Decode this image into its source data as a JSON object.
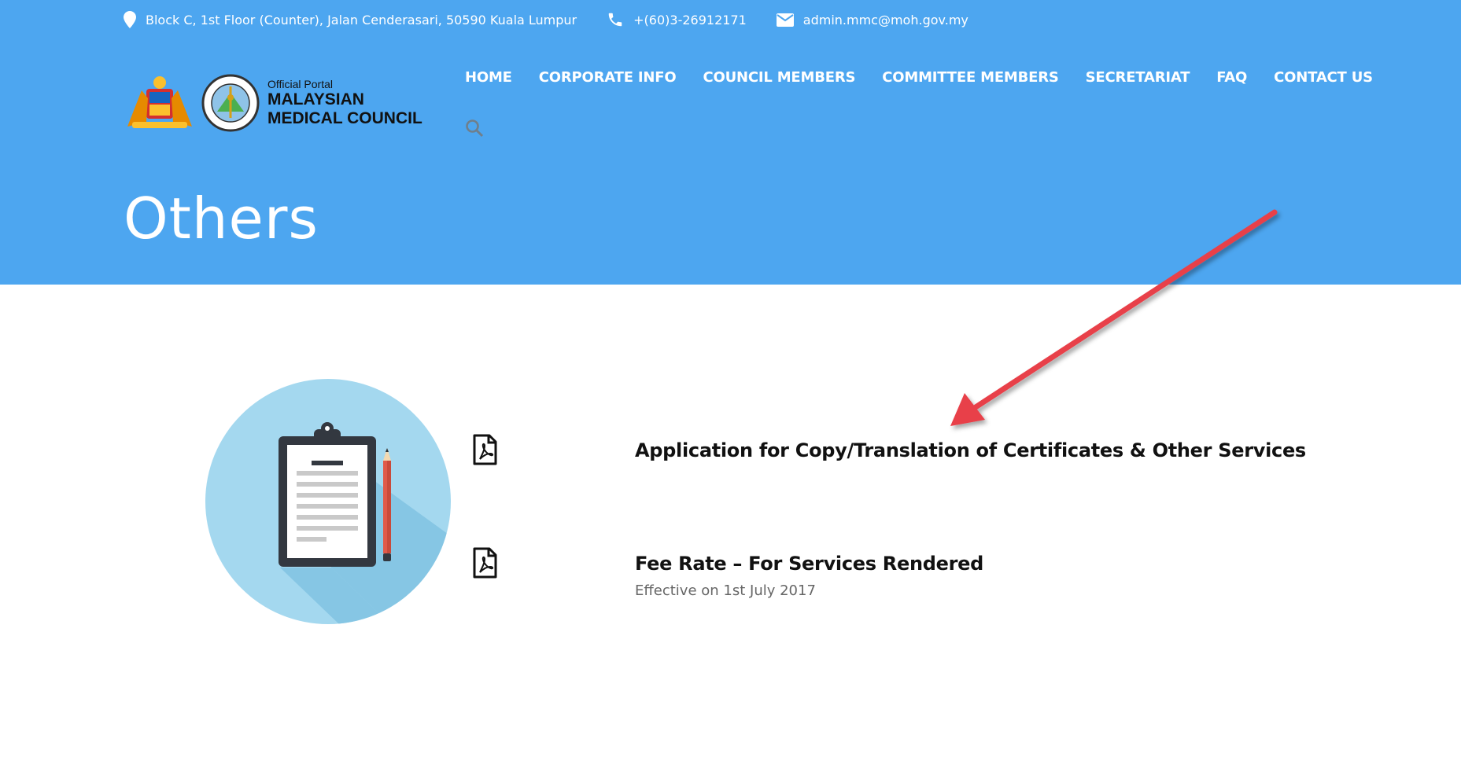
{
  "topbar": {
    "address": "Block C, 1st Floor (Counter), Jalan Cenderasari, 50590 Kuala Lumpur",
    "phone": "+(60)3-26912171",
    "email": "admin.mmc@moh.gov.my"
  },
  "brand": {
    "line1": "Official Portal",
    "line2": "MALAYSIAN",
    "line3": "MEDICAL COUNCIL"
  },
  "nav": {
    "items": [
      "HOME",
      "CORPORATE INFO",
      "COUNCIL MEMBERS",
      "COMMITTEE MEMBERS",
      "SECRETARIAT",
      "FAQ",
      "CONTACT US"
    ]
  },
  "page": {
    "title": "Others"
  },
  "documents": [
    {
      "title": "Application for Copy/Translation of Certificates & Other Services",
      "subtitle": ""
    },
    {
      "title": "Fee Rate – For Services Rendered",
      "subtitle": "Effective on 1st July 2017"
    }
  ],
  "colors": {
    "header": "#4da6f0",
    "arrow": "#e8404a",
    "illustration_circle": "#a4d8ef"
  },
  "icons": [
    "map-pin-icon",
    "phone-icon",
    "envelope-icon",
    "search-icon",
    "pdf-file-icon",
    "clipboard-illustration",
    "annotation-arrow"
  ]
}
